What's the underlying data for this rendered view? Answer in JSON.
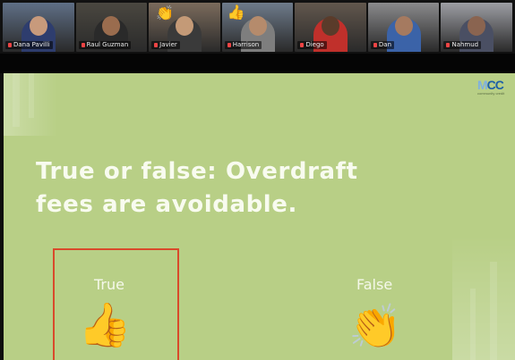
{
  "meeting": {
    "participants": [
      {
        "name": "Dana Pavilli",
        "bg": "#5f6f86",
        "skin": "#c89a7c",
        "shirt": "#2e3d6e",
        "reaction": ""
      },
      {
        "name": "Raul Guzman",
        "bg": "#4a4740",
        "skin": "#9a6c4e",
        "shirt": "#2a2a2a",
        "reaction": ""
      },
      {
        "name": "Javier",
        "bg": "#7b6b5c",
        "skin": "#c49a77",
        "shirt": "#3a3a3a",
        "reaction": "👏"
      },
      {
        "name": "Harrison",
        "bg": "#6e7b8b",
        "skin": "#b58b6c",
        "shirt": "#7e7e7e",
        "reaction": "👍"
      },
      {
        "name": "Diego",
        "bg": "#62574d",
        "skin": "#5a3b2a",
        "shirt": "#c0302b",
        "reaction": ""
      },
      {
        "name": "Dan",
        "bg": "#8a8a8c",
        "skin": "#a57a60",
        "shirt": "#3b63a8",
        "reaction": ""
      },
      {
        "name": "Nahmud",
        "bg": "#9d9ea4",
        "skin": "#8a6450",
        "shirt": "#4a4f63",
        "reaction": ""
      }
    ]
  },
  "slide": {
    "background": "#b8cf86",
    "logo": {
      "text_first": "M",
      "text_rest": "CC",
      "subtitle": "community credit"
    },
    "question": "True or false: Overdraft fees are avoidable.",
    "options": [
      {
        "label": "True",
        "emoji": "👍",
        "icon": "thumbs-up-icon",
        "selected": true
      },
      {
        "label": "False",
        "emoji": "👏",
        "icon": "clapping-hands-icon",
        "selected": false
      }
    ],
    "selection_color": "#d94a2b"
  }
}
